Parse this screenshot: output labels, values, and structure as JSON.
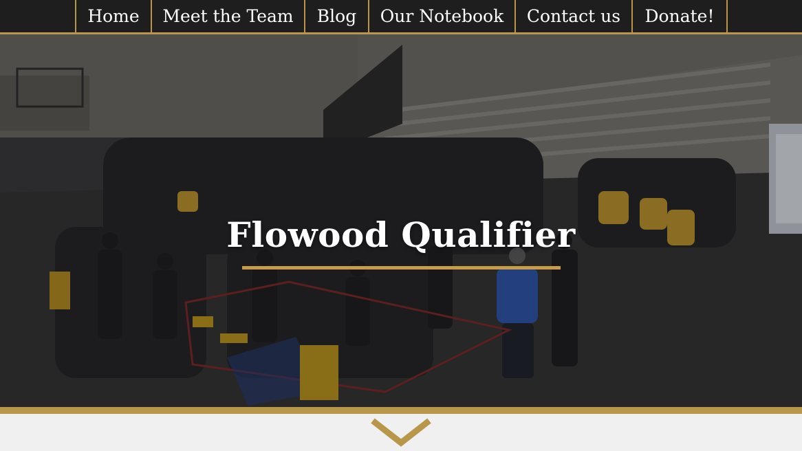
{
  "nav": {
    "items": [
      {
        "label": "Home"
      },
      {
        "label": "Meet the Team"
      },
      {
        "label": "Blog"
      },
      {
        "label": "Our Notebook"
      },
      {
        "label": "Contact us"
      },
      {
        "label": "Donate!"
      }
    ]
  },
  "hero": {
    "title": "Flowood Qualifier"
  },
  "scroll_icon": "chevron-down-icon",
  "colors": {
    "nav_bg": "#1e1e1e",
    "accent_gold": "#b8974a",
    "underline_gold": "#c89b48",
    "lower_bg": "#f0f0f0",
    "title_text": "#ffffff"
  }
}
